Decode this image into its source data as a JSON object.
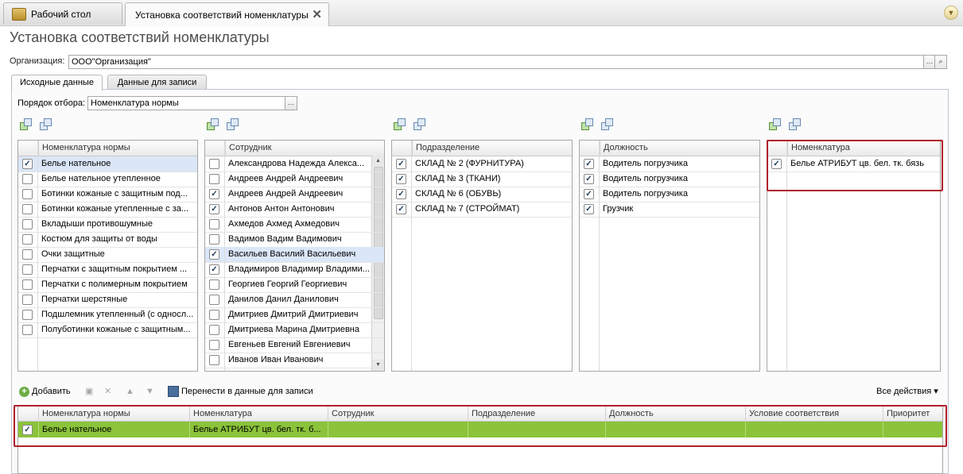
{
  "window_tabs": [
    {
      "label": "Рабочий стол"
    },
    {
      "label": "Установка соответствий номенклатуры"
    }
  ],
  "title": "Установка соответствий номенклатуры",
  "organization": {
    "label": "Организация:",
    "value": "ООО\"Организация\""
  },
  "form_tabs": [
    {
      "label": "Исходные данные"
    },
    {
      "label": "Данные для записи"
    }
  ],
  "order": {
    "label": "Порядок отбора:",
    "value": "Номенклатура нормы"
  },
  "grids": {
    "norm": {
      "header": "Номенклатура нормы",
      "rows": [
        {
          "text": "Белье нательное",
          "checked": true,
          "selected": true
        },
        {
          "text": "Белье нательное утепленное",
          "checked": false
        },
        {
          "text": "Ботинки кожаные с защитным под...",
          "checked": false
        },
        {
          "text": "Ботинки кожаные утепленные с за...",
          "checked": false
        },
        {
          "text": "Вкладыши противошумные",
          "checked": false
        },
        {
          "text": "Костюм для защиты от воды",
          "checked": false
        },
        {
          "text": "Очки защитные",
          "checked": false
        },
        {
          "text": "Перчатки с защитным покрытием ...",
          "checked": false
        },
        {
          "text": "Перчатки с полимерным покрытием",
          "checked": false
        },
        {
          "text": "Перчатки шерстяные",
          "checked": false
        },
        {
          "text": "Подшлемник утепленный (с односл...",
          "checked": false
        },
        {
          "text": "Полуботинки кожаные с защитным...",
          "checked": false
        }
      ]
    },
    "employee": {
      "header": "Сотрудник",
      "rows": [
        {
          "text": "Александрова Надежда Алекса...",
          "checked": false
        },
        {
          "text": "Андреев Андрей Андреевич",
          "checked": false
        },
        {
          "text": "Андреев Андрей Андреевич",
          "checked": true
        },
        {
          "text": "Антонов Антон Антонович",
          "checked": true
        },
        {
          "text": "Ахмедов Ахмед Ахмедович",
          "checked": false
        },
        {
          "text": "Вадимов Вадим Вадимович",
          "checked": false
        },
        {
          "text": "Васильев Василий Васильевич",
          "checked": true,
          "selected": true
        },
        {
          "text": "Владимиров Владимир Владими...",
          "checked": true
        },
        {
          "text": "Георгиев Георгий Георгиевич",
          "checked": false
        },
        {
          "text": "Данилов Данил Данилович",
          "checked": false
        },
        {
          "text": "Дмитриев Дмитрий Дмитриевич",
          "checked": false
        },
        {
          "text": "Дмитриева Марина Дмитриевна",
          "checked": false
        },
        {
          "text": "Евгеньев Евгений Евгениевич",
          "checked": false
        },
        {
          "text": "Иванов Иван Иванович",
          "checked": false
        }
      ]
    },
    "department": {
      "header": "Подразделение",
      "rows": [
        {
          "text": "СКЛАД № 2 (ФУРНИТУРА)",
          "checked": true
        },
        {
          "text": "СКЛАД № 3 (ТКАНИ)",
          "checked": true
        },
        {
          "text": "СКЛАД № 6 (ОБУВЬ)",
          "checked": true
        },
        {
          "text": "СКЛАД № 7 (СТРОЙМАТ)",
          "checked": true
        }
      ]
    },
    "position": {
      "header": "Должность",
      "rows": [
        {
          "text": "Водитель погрузчика",
          "checked": true
        },
        {
          "text": "Водитель погрузчика",
          "checked": true
        },
        {
          "text": "Водитель погрузчика",
          "checked": true
        },
        {
          "text": "Грузчик",
          "checked": true
        }
      ]
    },
    "nomenclature": {
      "header": "Номенклатура",
      "rows": [
        {
          "text": "Белье АТРИБУТ цв. бел. тк. бязь",
          "checked": true
        }
      ]
    }
  },
  "bottom_toolbar": {
    "add": "Добавить",
    "transfer": "Перенести в данные для записи",
    "all_actions": "Все действия ▾"
  },
  "result_table": {
    "headers": [
      "Номенклатура нормы",
      "Номенклатура",
      "Сотрудник",
      "Подразделение",
      "Должность",
      "Условие соответствия",
      "Приоритет"
    ],
    "rows": [
      {
        "checked": true,
        "cells": [
          "Белье нательное",
          "Белье АТРИБУТ цв. бел. тк. б...",
          "",
          "",
          "",
          "",
          ""
        ]
      }
    ]
  },
  "colors": {
    "highlight_row": "#8bc33a",
    "red_frame": "#b0202a",
    "selection": "#dbe7f8"
  }
}
